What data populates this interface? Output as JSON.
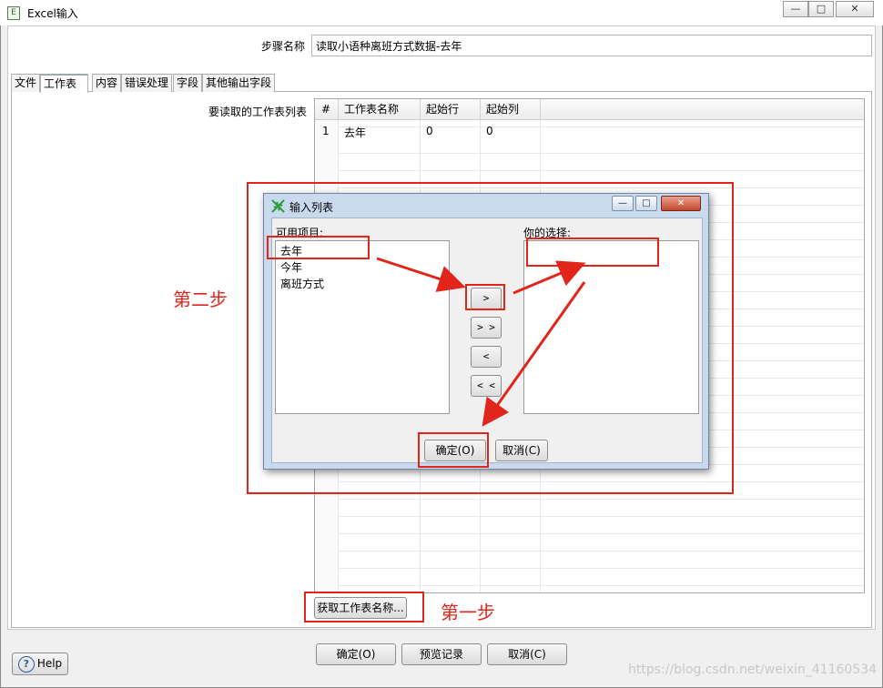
{
  "window": {
    "title": "Excel输入",
    "app_icon": "excel-input-icon",
    "controls": {
      "minimize": "—",
      "maximize": "□",
      "close": "✕"
    }
  },
  "step": {
    "label": "步骤名称",
    "value": "读取小语种离班方式数据-去年"
  },
  "tabs": [
    {
      "label": "文件",
      "active": false
    },
    {
      "label": "工作表",
      "active": true
    },
    {
      "label": "内容",
      "active": false
    },
    {
      "label": "错误处理",
      "active": false
    },
    {
      "label": "字段",
      "active": false
    },
    {
      "label": "其他输出字段",
      "active": false
    }
  ],
  "sheets": {
    "label": "要读取的工作表列表",
    "columns": [
      "#",
      "工作表名称",
      "起始行",
      "起始列"
    ],
    "rows": [
      [
        "1",
        "去年",
        "0",
        "0"
      ]
    ],
    "get_sheets_button": "获取工作表名称..."
  },
  "dialog": {
    "title": "输入列表",
    "available_label": "可用项目:",
    "available_items": [
      "去年",
      "今年",
      "离班方式"
    ],
    "selected_label": "你的选择:",
    "selected_items": [],
    "move_buttons": {
      "add": ">",
      "add_all": "> >",
      "remove": "<",
      "remove_all": "< <"
    },
    "ok": "确定(O)",
    "cancel": "取消(C)",
    "controls": {
      "minimize": "—",
      "maximize": "□",
      "close": "✕"
    }
  },
  "footer": {
    "help": "Help",
    "ok": "确定(O)",
    "preview": "预览记录",
    "cancel": "取消(C)"
  },
  "annotations": {
    "step_one": "第一步",
    "step_two": "第二步"
  },
  "watermark": "https://blog.csdn.net/weixin_41160534",
  "colors": {
    "annotation_red": "#e1251b",
    "dialog_frame": "#c9d9ee"
  }
}
